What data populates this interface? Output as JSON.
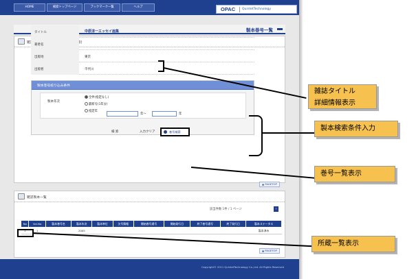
{
  "nav": {
    "tabs": [
      "HOME",
      "検索トップページ",
      "ブックマーク一覧",
      "ヘルプ"
    ],
    "logo_main": "OPAC",
    "logo_brand": "QuintetTechnology"
  },
  "page_title": "製本巻号一覧",
  "title_section": {
    "heading": "雑誌タイトル情報(巻号絞り込み検索)",
    "rows": [
      {
        "key": "タイトル",
        "value": "中原淳一エッセイ画集"
      },
      {
        "key": "著者名",
        "value": ""
      },
      {
        "key": "出版地",
        "value": "東京"
      },
      {
        "key": "出版者",
        "value": "千代川"
      }
    ]
  },
  "search": {
    "heading": "製本巻号絞り込み条件",
    "field_label": "製本年次",
    "radio_all": "全件(指定なし)",
    "radio_latest": "最新号(1年分)",
    "radio_range": "指定年",
    "range_from_unit": "年～",
    "range_to_unit": "年",
    "search_button": "検 索",
    "clear_button": "入力クリア",
    "volume_button": "巻号検索"
  },
  "pagetop_label": "▲ PAGETOP",
  "volume_section": {
    "heading": "雑誌製本一覧",
    "result_info": "該当件数 1件 / 1   ページ",
    "nav_arrow": "›",
    "columns": [
      "No",
      "Vol.No",
      "製本巻号名",
      "製本年次",
      "製本単位",
      "欠号情報",
      "開始巻号通号",
      "開始発行日",
      "終了巻号通号",
      "終了発行日",
      "製本ステータス"
    ],
    "rows": [
      [
        "1",
        "1",
        "",
        "2005",
        "",
        "",
        "",
        "",
        "",
        "",
        "製本済み"
      ]
    ]
  },
  "footer": "Copyright© 2011 QuintetTechnology Co.,Ltd. All Rights Reserved",
  "annotations": {
    "callout_title_line1": "雑誌タイトル",
    "callout_title_line2": "詳細情報表示",
    "callout_search": "製本検索条件入力",
    "callout_volume": "巻号一覧表示",
    "callout_holdings": "所蔵一覧表示"
  },
  "colors": {
    "brand_blue": "#1f3f8f",
    "callout": "#f6c14f",
    "search_head": "#6f8fd6"
  }
}
